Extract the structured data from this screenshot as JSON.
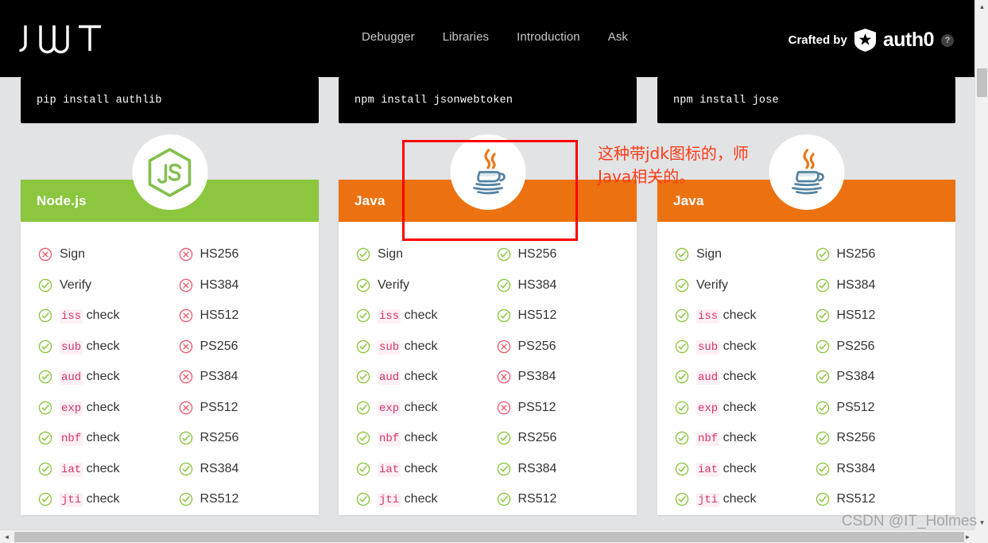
{
  "nav": {
    "logo_alt": "JWT",
    "links": [
      "Debugger",
      "Libraries",
      "Introduction",
      "Ask"
    ],
    "crafted_by": "Crafted by",
    "brand": "auth0",
    "help": "?"
  },
  "columns": [
    {
      "install_command": "pip install authlib",
      "library_name": "Node.js",
      "header_color": "#8cc63f",
      "icon": "nodejs-icon",
      "features_left": [
        {
          "label": "Sign",
          "code": null,
          "suffix": null,
          "status": "no"
        },
        {
          "label": "Verify",
          "code": null,
          "suffix": null,
          "status": "yes"
        },
        {
          "label": null,
          "code": "iss",
          "suffix": " check",
          "status": "yes"
        },
        {
          "label": null,
          "code": "sub",
          "suffix": " check",
          "status": "yes"
        },
        {
          "label": null,
          "code": "aud",
          "suffix": " check",
          "status": "yes"
        },
        {
          "label": null,
          "code": "exp",
          "suffix": " check",
          "status": "yes"
        },
        {
          "label": null,
          "code": "nbf",
          "suffix": " check",
          "status": "yes"
        },
        {
          "label": null,
          "code": "iat",
          "suffix": " check",
          "status": "yes"
        },
        {
          "label": null,
          "code": "jti",
          "suffix": " check",
          "status": "yes"
        }
      ],
      "features_right": [
        {
          "label": "HS256",
          "code": null,
          "suffix": null,
          "status": "no"
        },
        {
          "label": "HS384",
          "code": null,
          "suffix": null,
          "status": "no"
        },
        {
          "label": "HS512",
          "code": null,
          "suffix": null,
          "status": "no"
        },
        {
          "label": "PS256",
          "code": null,
          "suffix": null,
          "status": "no"
        },
        {
          "label": "PS384",
          "code": null,
          "suffix": null,
          "status": "no"
        },
        {
          "label": "PS512",
          "code": null,
          "suffix": null,
          "status": "no"
        },
        {
          "label": "RS256",
          "code": null,
          "suffix": null,
          "status": "yes"
        },
        {
          "label": "RS384",
          "code": null,
          "suffix": null,
          "status": "yes"
        },
        {
          "label": "RS512",
          "code": null,
          "suffix": null,
          "status": "yes"
        }
      ]
    },
    {
      "install_command": "npm install jsonwebtoken",
      "library_name": "Java",
      "header_color": "#ec7211",
      "icon": "java-icon",
      "features_left": [
        {
          "label": "Sign",
          "code": null,
          "suffix": null,
          "status": "yes"
        },
        {
          "label": "Verify",
          "code": null,
          "suffix": null,
          "status": "yes"
        },
        {
          "label": null,
          "code": "iss",
          "suffix": " check",
          "status": "yes"
        },
        {
          "label": null,
          "code": "sub",
          "suffix": " check",
          "status": "yes"
        },
        {
          "label": null,
          "code": "aud",
          "suffix": " check",
          "status": "yes"
        },
        {
          "label": null,
          "code": "exp",
          "suffix": " check",
          "status": "yes"
        },
        {
          "label": null,
          "code": "nbf",
          "suffix": " check",
          "status": "yes"
        },
        {
          "label": null,
          "code": "iat",
          "suffix": " check",
          "status": "yes"
        },
        {
          "label": null,
          "code": "jti",
          "suffix": " check",
          "status": "yes"
        }
      ],
      "features_right": [
        {
          "label": "HS256",
          "code": null,
          "suffix": null,
          "status": "yes"
        },
        {
          "label": "HS384",
          "code": null,
          "suffix": null,
          "status": "yes"
        },
        {
          "label": "HS512",
          "code": null,
          "suffix": null,
          "status": "yes"
        },
        {
          "label": "PS256",
          "code": null,
          "suffix": null,
          "status": "no"
        },
        {
          "label": "PS384",
          "code": null,
          "suffix": null,
          "status": "no"
        },
        {
          "label": "PS512",
          "code": null,
          "suffix": null,
          "status": "no"
        },
        {
          "label": "RS256",
          "code": null,
          "suffix": null,
          "status": "yes"
        },
        {
          "label": "RS384",
          "code": null,
          "suffix": null,
          "status": "yes"
        },
        {
          "label": "RS512",
          "code": null,
          "suffix": null,
          "status": "yes"
        }
      ]
    },
    {
      "install_command": "npm install jose",
      "library_name": "Java",
      "header_color": "#ec7211",
      "icon": "java-icon",
      "features_left": [
        {
          "label": "Sign",
          "code": null,
          "suffix": null,
          "status": "yes"
        },
        {
          "label": "Verify",
          "code": null,
          "suffix": null,
          "status": "yes"
        },
        {
          "label": null,
          "code": "iss",
          "suffix": " check",
          "status": "yes"
        },
        {
          "label": null,
          "code": "sub",
          "suffix": " check",
          "status": "yes"
        },
        {
          "label": null,
          "code": "aud",
          "suffix": " check",
          "status": "yes"
        },
        {
          "label": null,
          "code": "exp",
          "suffix": " check",
          "status": "yes"
        },
        {
          "label": null,
          "code": "nbf",
          "suffix": " check",
          "status": "yes"
        },
        {
          "label": null,
          "code": "iat",
          "suffix": " check",
          "status": "yes"
        },
        {
          "label": null,
          "code": "jti",
          "suffix": " check",
          "status": "yes"
        }
      ],
      "features_right": [
        {
          "label": "HS256",
          "code": null,
          "suffix": null,
          "status": "yes"
        },
        {
          "label": "HS384",
          "code": null,
          "suffix": null,
          "status": "yes"
        },
        {
          "label": "HS512",
          "code": null,
          "suffix": null,
          "status": "yes"
        },
        {
          "label": "PS256",
          "code": null,
          "suffix": null,
          "status": "yes"
        },
        {
          "label": "PS384",
          "code": null,
          "suffix": null,
          "status": "yes"
        },
        {
          "label": "PS512",
          "code": null,
          "suffix": null,
          "status": "yes"
        },
        {
          "label": "RS256",
          "code": null,
          "suffix": null,
          "status": "yes"
        },
        {
          "label": "RS384",
          "code": null,
          "suffix": null,
          "status": "yes"
        },
        {
          "label": "RS512",
          "code": null,
          "suffix": null,
          "status": "yes"
        }
      ]
    }
  ],
  "annotation": {
    "line1": "这种带jdk图标的，师",
    "line2": "Java相关的。",
    "color": "#ff3b17"
  },
  "watermark": "CSDN @IT_Holmes",
  "colors": {
    "nodejs_green": "#8cc63f",
    "java_orange": "#ec7211",
    "check_green": "#8cc63f",
    "cross_red": "#ef5a6f",
    "page_bg": "#e2e3e5",
    "highlight_red": "#ff0000"
  },
  "scrollbars": {
    "up_arrow": "▲",
    "down_arrow": "▼",
    "left_arrow": "◄",
    "right_arrow": "►"
  }
}
